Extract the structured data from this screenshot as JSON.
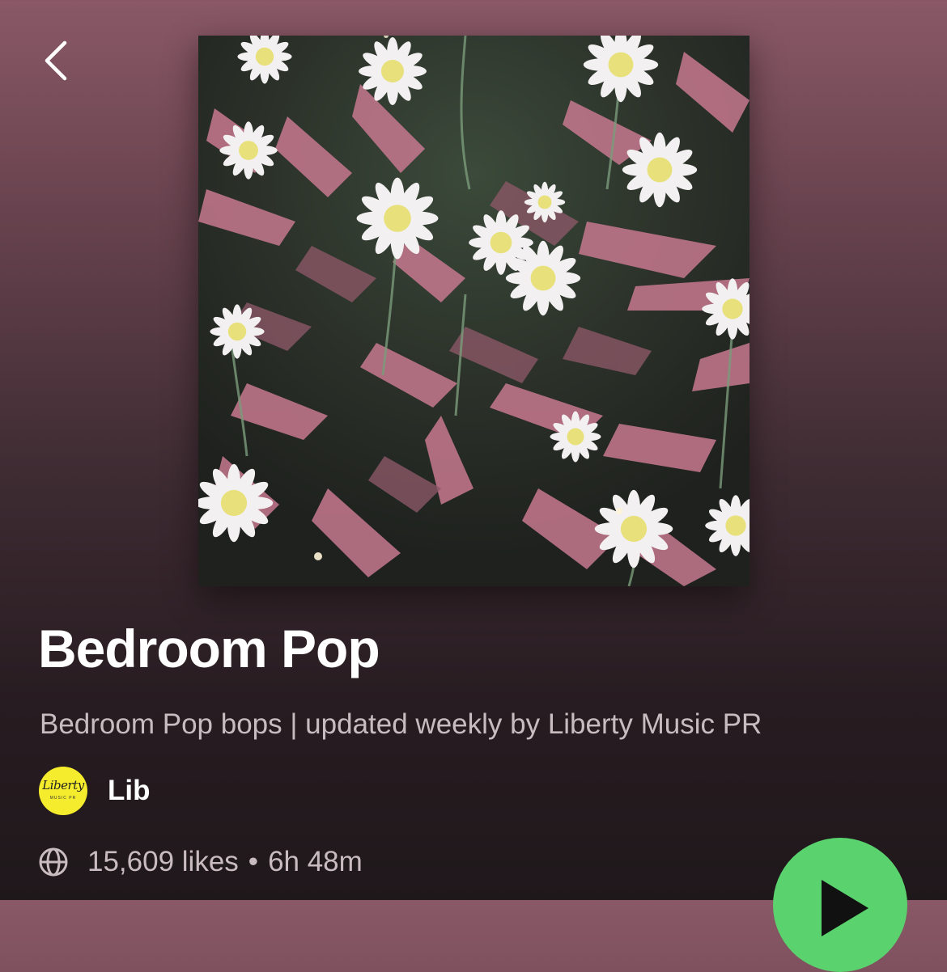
{
  "header": {
    "back_icon": "chevron-left-icon"
  },
  "cover": {
    "alt": "daisy flowers artwork"
  },
  "playlist": {
    "title": "Bedroom Pop",
    "description": "Bedroom Pop bops | updated weekly by Liberty Music PR",
    "owner": {
      "name": "Lib",
      "avatar_text": "Liberty",
      "avatar_subtext": "MUSIC PR",
      "avatar_color": "#f4ec2c"
    },
    "likes": "15,609 likes",
    "separator": "•",
    "duration": "6h 48m"
  },
  "colors": {
    "play_button": "#5ad26e",
    "background_top": "#8a5866",
    "background_bottom": "#1f181b"
  },
  "icons": {
    "globe": "globe-icon",
    "play": "play-icon"
  }
}
